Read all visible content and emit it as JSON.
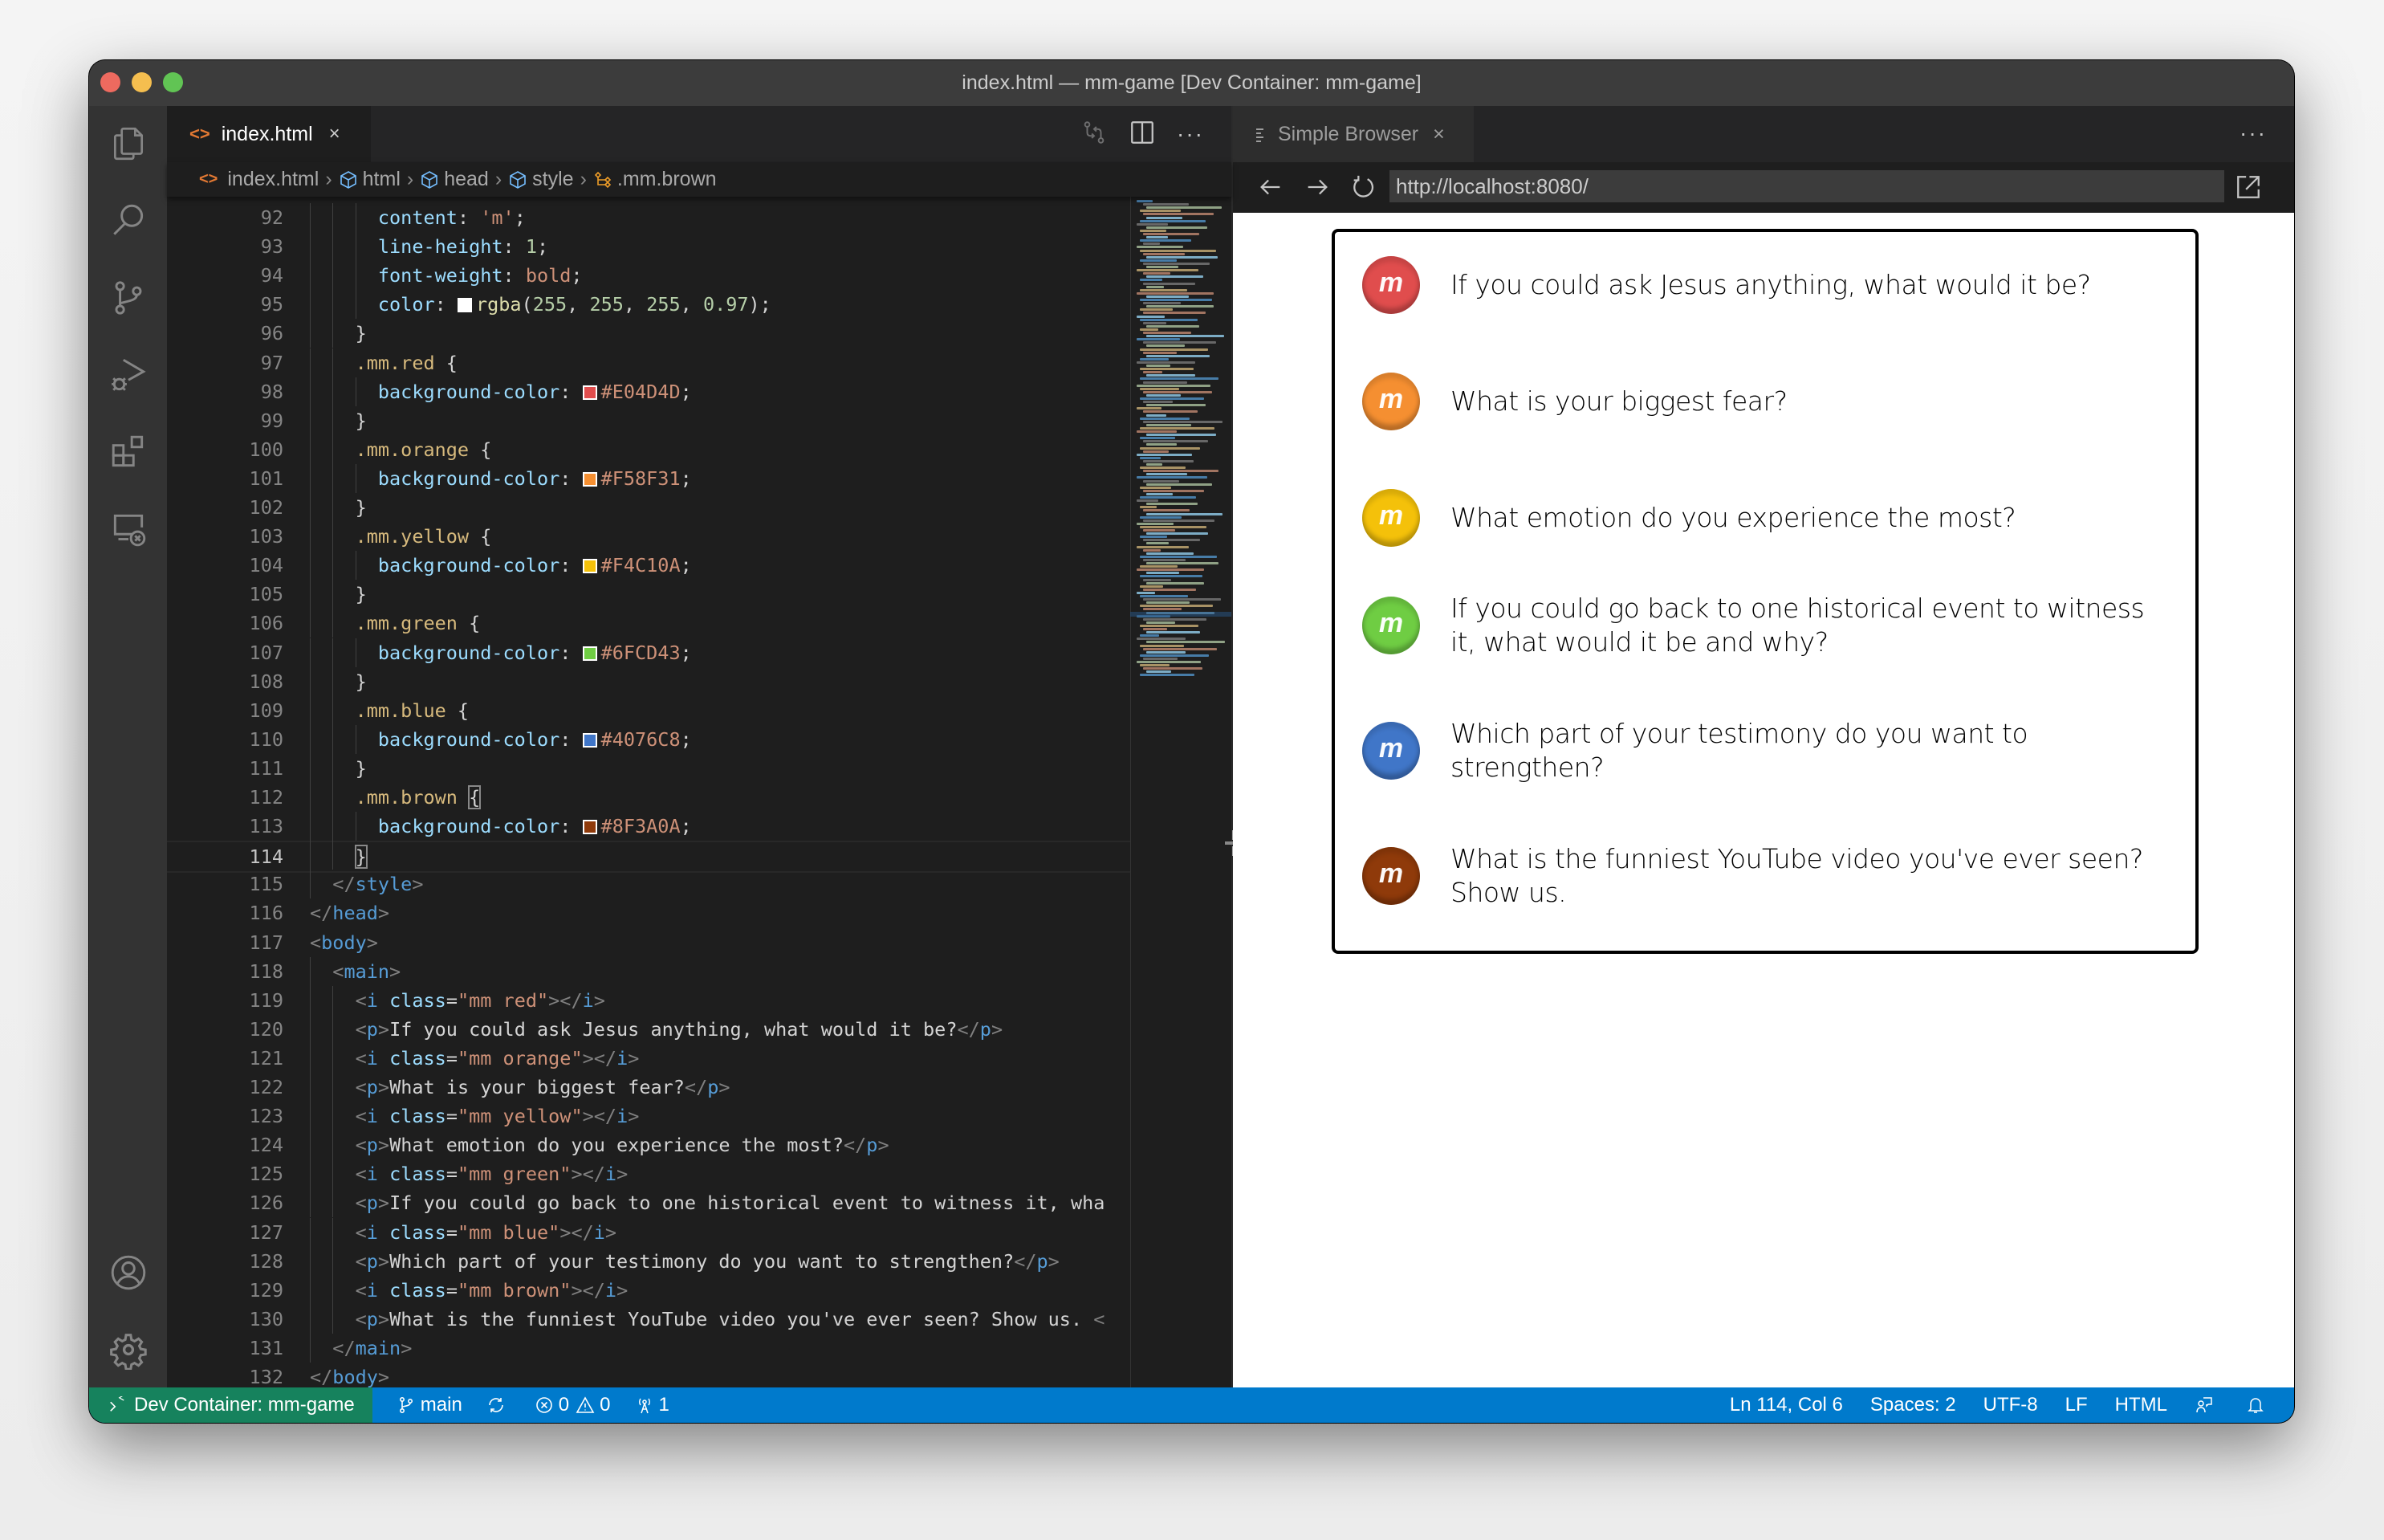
{
  "window": {
    "title": "index.html — mm-game [Dev Container: mm-game]"
  },
  "activity_bar": {
    "items": [
      {
        "name": "explorer",
        "icon": "files-icon"
      },
      {
        "name": "search",
        "icon": "search-icon"
      },
      {
        "name": "source-control",
        "icon": "source-control-icon"
      },
      {
        "name": "run-and-debug",
        "icon": "debug-icon"
      },
      {
        "name": "extensions",
        "icon": "extensions-icon"
      },
      {
        "name": "remote-explorer",
        "icon": "remote-explorer-icon"
      }
    ],
    "bottom_items": [
      {
        "name": "accounts",
        "icon": "account-icon"
      },
      {
        "name": "manage",
        "icon": "gear-icon"
      }
    ]
  },
  "editor": {
    "tab": {
      "label": "index.html",
      "close": "×"
    },
    "breadcrumb": [
      "index.html",
      "html",
      "head",
      "style",
      ".mm.brown"
    ],
    "breadcrumb_sep": "›",
    "current_line": 114,
    "lines": [
      {
        "n": "92",
        "indent": 3,
        "tokens": [
          [
            "prop",
            "content"
          ],
          [
            "p",
            ": "
          ],
          [
            "str",
            "'m'"
          ],
          [
            "p",
            ";"
          ]
        ]
      },
      {
        "n": "93",
        "indent": 3,
        "tokens": [
          [
            "prop",
            "line-height"
          ],
          [
            "p",
            ": "
          ],
          [
            "num",
            "1"
          ],
          [
            "p",
            ";"
          ]
        ]
      },
      {
        "n": "94",
        "indent": 3,
        "tokens": [
          [
            "prop",
            "font-weight"
          ],
          [
            "p",
            ": "
          ],
          [
            "str",
            "bold"
          ],
          [
            "p",
            ";"
          ]
        ]
      },
      {
        "n": "95",
        "indent": 3,
        "tokens": [
          [
            "prop",
            "color"
          ],
          [
            "p",
            ": "
          ],
          [
            "swatch",
            "#FFFFFF"
          ],
          [
            "fn",
            "rgba"
          ],
          [
            "p",
            "("
          ],
          [
            "num",
            "255"
          ],
          [
            "p",
            ", "
          ],
          [
            "num",
            "255"
          ],
          [
            "p",
            ", "
          ],
          [
            "num",
            "255"
          ],
          [
            "p",
            ", "
          ],
          [
            "num",
            "0.97"
          ],
          [
            "p",
            ");"
          ]
        ]
      },
      {
        "n": "96",
        "indent": 2,
        "tokens": [
          [
            "p",
            "}"
          ]
        ]
      },
      {
        "n": "97",
        "indent": 2,
        "tokens": [
          [
            "sel",
            ".mm.red"
          ],
          [
            "p",
            " {"
          ]
        ]
      },
      {
        "n": "98",
        "indent": 3,
        "tokens": [
          [
            "prop",
            "background-color"
          ],
          [
            "p",
            ": "
          ],
          [
            "swatch",
            "#E04D4D"
          ],
          [
            "str",
            "#E04D4D"
          ],
          [
            "p",
            ";"
          ]
        ]
      },
      {
        "n": "99",
        "indent": 2,
        "tokens": [
          [
            "p",
            "}"
          ]
        ]
      },
      {
        "n": "100",
        "indent": 2,
        "tokens": [
          [
            "sel",
            ".mm.orange"
          ],
          [
            "p",
            " {"
          ]
        ]
      },
      {
        "n": "101",
        "indent": 3,
        "tokens": [
          [
            "prop",
            "background-color"
          ],
          [
            "p",
            ": "
          ],
          [
            "swatch",
            "#F58F31"
          ],
          [
            "str",
            "#F58F31"
          ],
          [
            "p",
            ";"
          ]
        ]
      },
      {
        "n": "102",
        "indent": 2,
        "tokens": [
          [
            "p",
            "}"
          ]
        ]
      },
      {
        "n": "103",
        "indent": 2,
        "tokens": [
          [
            "sel",
            ".mm.yellow"
          ],
          [
            "p",
            " {"
          ]
        ]
      },
      {
        "n": "104",
        "indent": 3,
        "tokens": [
          [
            "prop",
            "background-color"
          ],
          [
            "p",
            ": "
          ],
          [
            "swatch",
            "#F4C10A"
          ],
          [
            "str",
            "#F4C10A"
          ],
          [
            "p",
            ";"
          ]
        ]
      },
      {
        "n": "105",
        "indent": 2,
        "tokens": [
          [
            "p",
            "}"
          ]
        ]
      },
      {
        "n": "106",
        "indent": 2,
        "tokens": [
          [
            "sel",
            ".mm.green"
          ],
          [
            "p",
            " {"
          ]
        ]
      },
      {
        "n": "107",
        "indent": 3,
        "tokens": [
          [
            "prop",
            "background-color"
          ],
          [
            "p",
            ": "
          ],
          [
            "swatch",
            "#6FCD43"
          ],
          [
            "str",
            "#6FCD43"
          ],
          [
            "p",
            ";"
          ]
        ]
      },
      {
        "n": "108",
        "indent": 2,
        "tokens": [
          [
            "p",
            "}"
          ]
        ]
      },
      {
        "n": "109",
        "indent": 2,
        "tokens": [
          [
            "sel",
            ".mm.blue"
          ],
          [
            "p",
            " {"
          ]
        ]
      },
      {
        "n": "110",
        "indent": 3,
        "tokens": [
          [
            "prop",
            "background-color"
          ],
          [
            "p",
            ": "
          ],
          [
            "swatch",
            "#4076C8"
          ],
          [
            "str",
            "#4076C8"
          ],
          [
            "p",
            ";"
          ]
        ]
      },
      {
        "n": "111",
        "indent": 2,
        "tokens": [
          [
            "p",
            "}"
          ]
        ]
      },
      {
        "n": "112",
        "indent": 2,
        "tokens": [
          [
            "sel",
            ".mm.brown"
          ],
          [
            "p",
            " "
          ],
          [
            "bracket",
            "{"
          ]
        ]
      },
      {
        "n": "113",
        "indent": 3,
        "tokens": [
          [
            "prop",
            "background-color"
          ],
          [
            "p",
            ": "
          ],
          [
            "swatch",
            "#8F3A0A"
          ],
          [
            "str",
            "#8F3A0A"
          ],
          [
            "p",
            ";"
          ]
        ]
      },
      {
        "n": "114",
        "indent": 2,
        "tokens": [
          [
            "bracket",
            "}"
          ]
        ]
      },
      {
        "n": "115",
        "indent": 1,
        "tokens": [
          [
            "br",
            "</"
          ],
          [
            "tag",
            "style"
          ],
          [
            "br",
            ">"
          ]
        ]
      },
      {
        "n": "116",
        "indent": 0,
        "tokens": [
          [
            "br",
            "</"
          ],
          [
            "tag",
            "head"
          ],
          [
            "br",
            ">"
          ]
        ]
      },
      {
        "n": "117",
        "indent": 0,
        "tokens": [
          [
            "br",
            "<"
          ],
          [
            "tag",
            "body"
          ],
          [
            "br",
            ">"
          ]
        ]
      },
      {
        "n": "118",
        "indent": 1,
        "tokens": [
          [
            "br",
            "<"
          ],
          [
            "tag",
            "main"
          ],
          [
            "br",
            ">"
          ]
        ]
      },
      {
        "n": "119",
        "indent": 2,
        "tokens": [
          [
            "br",
            "<"
          ],
          [
            "tag",
            "i"
          ],
          [
            "p",
            " "
          ],
          [
            "attr",
            "class"
          ],
          [
            "p",
            "="
          ],
          [
            "str",
            "\"mm red\""
          ],
          [
            "br",
            "></"
          ],
          [
            "tag",
            "i"
          ],
          [
            "br",
            ">"
          ]
        ]
      },
      {
        "n": "120",
        "indent": 2,
        "tokens": [
          [
            "br",
            "<"
          ],
          [
            "tag",
            "p"
          ],
          [
            "br",
            ">"
          ],
          [
            "p",
            "If you could ask Jesus anything, what would it be?"
          ],
          [
            "br",
            "</"
          ],
          [
            "tag",
            "p"
          ],
          [
            "br",
            ">"
          ]
        ]
      },
      {
        "n": "121",
        "indent": 2,
        "tokens": [
          [
            "br",
            "<"
          ],
          [
            "tag",
            "i"
          ],
          [
            "p",
            " "
          ],
          [
            "attr",
            "class"
          ],
          [
            "p",
            "="
          ],
          [
            "str",
            "\"mm orange\""
          ],
          [
            "br",
            "></"
          ],
          [
            "tag",
            "i"
          ],
          [
            "br",
            ">"
          ]
        ]
      },
      {
        "n": "122",
        "indent": 2,
        "tokens": [
          [
            "br",
            "<"
          ],
          [
            "tag",
            "p"
          ],
          [
            "br",
            ">"
          ],
          [
            "p",
            "What is your biggest fear?"
          ],
          [
            "br",
            "</"
          ],
          [
            "tag",
            "p"
          ],
          [
            "br",
            ">"
          ]
        ]
      },
      {
        "n": "123",
        "indent": 2,
        "tokens": [
          [
            "br",
            "<"
          ],
          [
            "tag",
            "i"
          ],
          [
            "p",
            " "
          ],
          [
            "attr",
            "class"
          ],
          [
            "p",
            "="
          ],
          [
            "str",
            "\"mm yellow\""
          ],
          [
            "br",
            "></"
          ],
          [
            "tag",
            "i"
          ],
          [
            "br",
            ">"
          ]
        ]
      },
      {
        "n": "124",
        "indent": 2,
        "tokens": [
          [
            "br",
            "<"
          ],
          [
            "tag",
            "p"
          ],
          [
            "br",
            ">"
          ],
          [
            "p",
            "What emotion do you experience the most?"
          ],
          [
            "br",
            "</"
          ],
          [
            "tag",
            "p"
          ],
          [
            "br",
            ">"
          ]
        ]
      },
      {
        "n": "125",
        "indent": 2,
        "tokens": [
          [
            "br",
            "<"
          ],
          [
            "tag",
            "i"
          ],
          [
            "p",
            " "
          ],
          [
            "attr",
            "class"
          ],
          [
            "p",
            "="
          ],
          [
            "str",
            "\"mm green\""
          ],
          [
            "br",
            "></"
          ],
          [
            "tag",
            "i"
          ],
          [
            "br",
            ">"
          ]
        ]
      },
      {
        "n": "126",
        "indent": 2,
        "tokens": [
          [
            "br",
            "<"
          ],
          [
            "tag",
            "p"
          ],
          [
            "br",
            ">"
          ],
          [
            "p",
            "If you could go back to one historical event to witness it, wha"
          ]
        ]
      },
      {
        "n": "127",
        "indent": 2,
        "tokens": [
          [
            "br",
            "<"
          ],
          [
            "tag",
            "i"
          ],
          [
            "p",
            " "
          ],
          [
            "attr",
            "class"
          ],
          [
            "p",
            "="
          ],
          [
            "str",
            "\"mm blue\""
          ],
          [
            "br",
            "></"
          ],
          [
            "tag",
            "i"
          ],
          [
            "br",
            ">"
          ]
        ]
      },
      {
        "n": "128",
        "indent": 2,
        "tokens": [
          [
            "br",
            "<"
          ],
          [
            "tag",
            "p"
          ],
          [
            "br",
            ">"
          ],
          [
            "p",
            "Which part of your testimony do you want to strengthen?"
          ],
          [
            "br",
            "</"
          ],
          [
            "tag",
            "p"
          ],
          [
            "br",
            ">"
          ]
        ]
      },
      {
        "n": "129",
        "indent": 2,
        "tokens": [
          [
            "br",
            "<"
          ],
          [
            "tag",
            "i"
          ],
          [
            "p",
            " "
          ],
          [
            "attr",
            "class"
          ],
          [
            "p",
            "="
          ],
          [
            "str",
            "\"mm brown\""
          ],
          [
            "br",
            "></"
          ],
          [
            "tag",
            "i"
          ],
          [
            "br",
            ">"
          ]
        ]
      },
      {
        "n": "130",
        "indent": 2,
        "tokens": [
          [
            "br",
            "<"
          ],
          [
            "tag",
            "p"
          ],
          [
            "br",
            ">"
          ],
          [
            "p",
            "What is the funniest YouTube video you've ever seen? Show us. "
          ],
          [
            "br",
            "<"
          ]
        ]
      },
      {
        "n": "131",
        "indent": 1,
        "tokens": [
          [
            "br",
            "</"
          ],
          [
            "tag",
            "main"
          ],
          [
            "br",
            ">"
          ]
        ]
      },
      {
        "n": "132",
        "indent": 0,
        "tokens": [
          [
            "br",
            "</"
          ],
          [
            "tag",
            "body"
          ],
          [
            "br",
            ">"
          ]
        ]
      }
    ]
  },
  "browser": {
    "tab": {
      "label": "Simple Browser",
      "close": "×"
    },
    "more": "···",
    "url": "http://localhost:8080/",
    "questions": [
      {
        "color": "#E04D4D",
        "glyph": "m",
        "text": "If you could ask Jesus anything, what would it be?"
      },
      {
        "color": "#F58F31",
        "glyph": "m",
        "text": "What is your biggest fear?"
      },
      {
        "color": "#F4C10A",
        "glyph": "m",
        "text": "What emotion do you experience the most?"
      },
      {
        "color": "#6FCD43",
        "glyph": "m",
        "text": "If you could go back to one historical event to witness it, what would it be and why?"
      },
      {
        "color": "#4076C8",
        "glyph": "m",
        "text": "Which part of your testimony do you want to strengthen?"
      },
      {
        "color": "#8F3A0A",
        "glyph": "m",
        "text": "What is the funniest YouTube video you've ever seen? Show us."
      }
    ]
  },
  "status_bar": {
    "remote": "Dev Container: mm-game",
    "branch": "main",
    "errors": "0",
    "warnings": "0",
    "ports": "1",
    "position": "Ln 114, Col 6",
    "indent": "Spaces: 2",
    "encoding": "UTF-8",
    "eol": "LF",
    "language": "HTML",
    "colors": {
      "remote": "#16825d",
      "bar": "#007acc"
    }
  }
}
